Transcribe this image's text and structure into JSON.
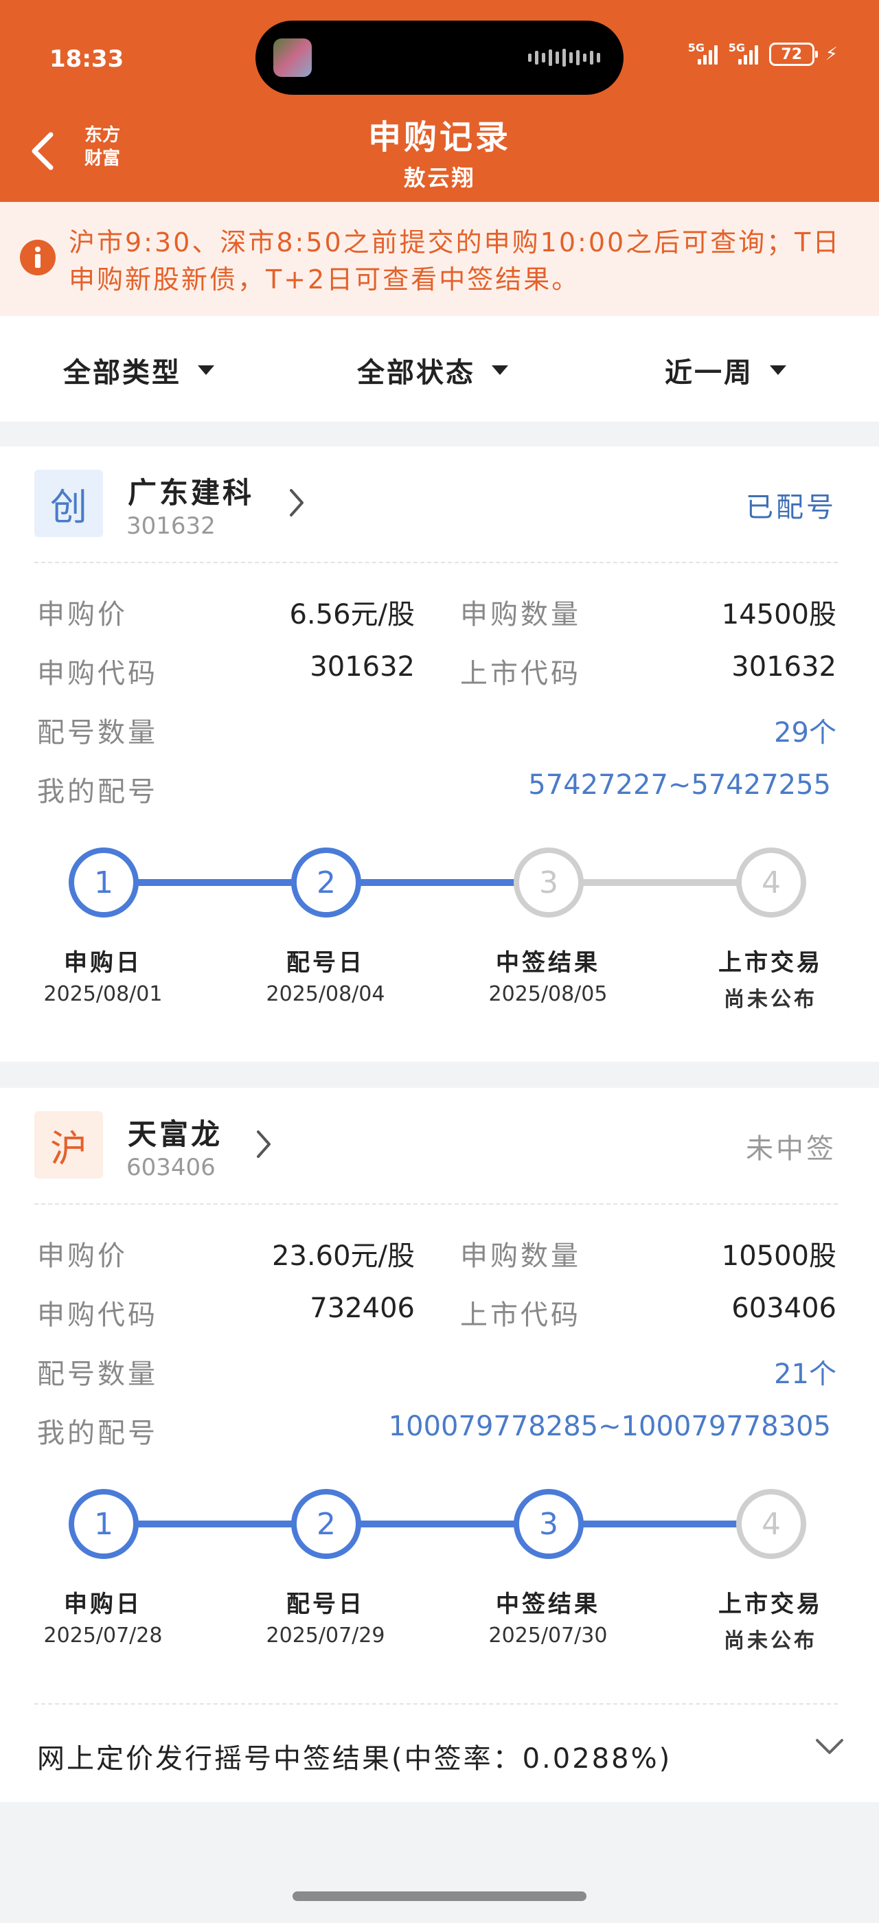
{
  "status_bar": {
    "time": "18:33",
    "network1": "5G",
    "network2": "5G",
    "battery": "72"
  },
  "header": {
    "title": "申购记录",
    "subtitle": "敖云翔",
    "logo_line1": "东方",
    "logo_line2": "财富"
  },
  "notice": {
    "text": "沪市9:30、深市8:50之前提交的申购10:00之后可查询；T日申购新股新债，T+2日可查看中签结果。"
  },
  "filters": [
    {
      "label": "全部类型"
    },
    {
      "label": "全部状态"
    },
    {
      "label": "近一周"
    }
  ],
  "labels": {
    "price": "申购价",
    "quantity": "申购数量",
    "sub_code": "申购代码",
    "list_code": "上市代码",
    "lot_count": "配号数量",
    "my_lots": "我的配号"
  },
  "cards": [
    {
      "badge": "创",
      "name": "广东建科",
      "code": "301632",
      "status": "已配号",
      "price": "6.56元/股",
      "quantity": "14500股",
      "sub_code": "301632",
      "list_code": "301632",
      "lot_count": "29个",
      "my_lots": "57427227~57427255",
      "steps": [
        {
          "num": "1",
          "label": "申购日",
          "date": "2025/08/01",
          "active": true
        },
        {
          "num": "2",
          "label": "配号日",
          "date": "2025/08/04",
          "active": true
        },
        {
          "num": "3",
          "label": "中签结果",
          "date": "2025/08/05",
          "active": false
        },
        {
          "num": "4",
          "label": "上市交易",
          "date": "尚未公布",
          "active": false
        }
      ]
    },
    {
      "badge": "沪",
      "name": "天富龙",
      "code": "603406",
      "status": "未中签",
      "price": "23.60元/股",
      "quantity": "10500股",
      "sub_code": "732406",
      "list_code": "603406",
      "lot_count": "21个",
      "my_lots": "100079778285~100079778305",
      "steps": [
        {
          "num": "1",
          "label": "申购日",
          "date": "2025/07/28",
          "active": true
        },
        {
          "num": "2",
          "label": "配号日",
          "date": "2025/07/29",
          "active": true
        },
        {
          "num": "3",
          "label": "中签结果",
          "date": "2025/07/30",
          "active": true
        },
        {
          "num": "4",
          "label": "上市交易",
          "date": "尚未公布",
          "active": false
        }
      ],
      "result_text": "网上定价发行摇号中签结果(中签率：0.0288%)"
    }
  ],
  "colors": {
    "brand": "#e4612a",
    "blue": "#4a7bd8",
    "status_ok": "#3e6fb8",
    "muted": "#999999"
  }
}
